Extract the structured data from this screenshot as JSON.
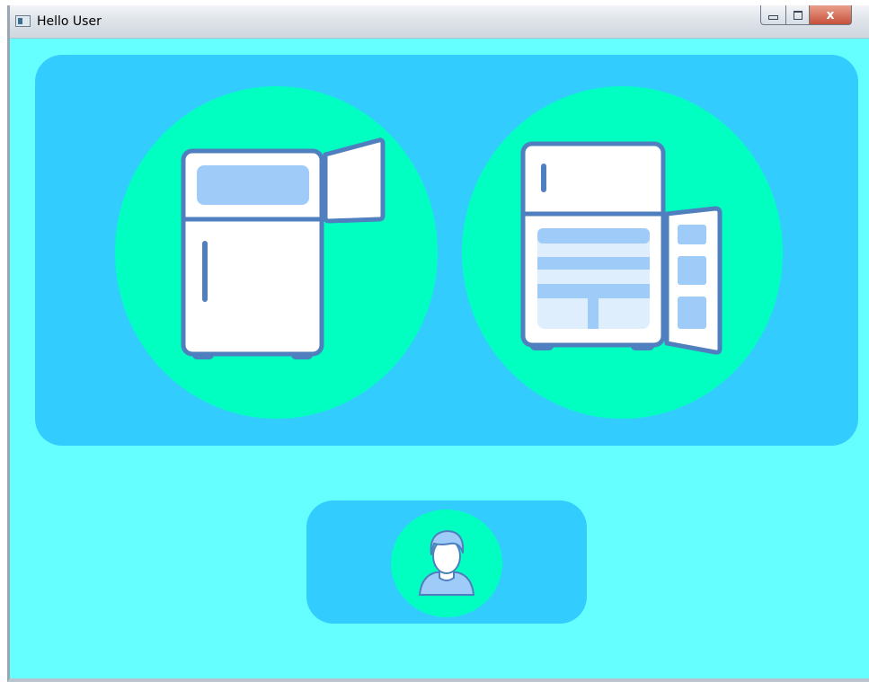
{
  "window": {
    "title": "Hello User",
    "controls": {
      "minimize": "minimize",
      "maximize": "maximize",
      "close": "x"
    }
  },
  "colors": {
    "background": "#66ffff",
    "panel": "#33ccff",
    "button_circle": "#00ffc0",
    "icon_stroke": "#4f7fbf",
    "icon_fill": "#ffffff",
    "icon_accent": "#9ecbf7"
  },
  "icons": {
    "fridge_freezer_open": "fridge-freezer-door-open-icon",
    "fridge_main_open": "fridge-main-door-open-icon",
    "user": "user-avatar-icon"
  }
}
